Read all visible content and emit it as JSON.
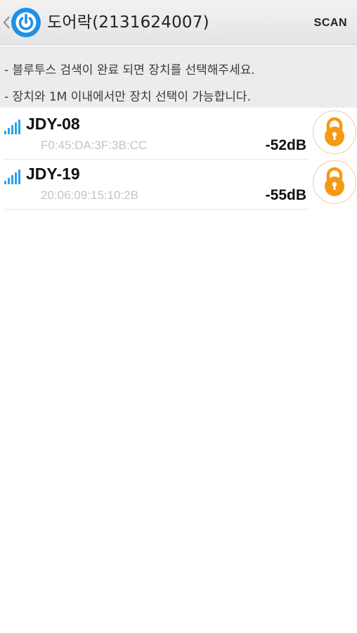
{
  "header": {
    "title": "도어락(2131624007)",
    "scan_label": "SCAN",
    "back_icon": "chevron-left-icon",
    "logo_icon": "power-icon",
    "accent_color": "#1e90e8"
  },
  "info": {
    "line1": "- 블루투스 검색이 완료 되면 장치를 선택해주세요.",
    "line2": "- 장치와 1M 이내에서만 장치 선택이 가능합니다."
  },
  "devices": [
    {
      "name": "JDY-08",
      "address": "F0:45:DA:3F:3B:CC",
      "rssi": "-52dB",
      "signal_icon": "signal-bars-icon",
      "action_icon": "padlock-icon"
    },
    {
      "name": "JDY-19",
      "address": "20:06:09:15:10:2B",
      "rssi": "-55dB",
      "signal_icon": "signal-bars-icon",
      "action_icon": "padlock-icon"
    }
  ],
  "colors": {
    "lock_orange": "#f59a14",
    "signal_blue": "#2aa3e6"
  }
}
